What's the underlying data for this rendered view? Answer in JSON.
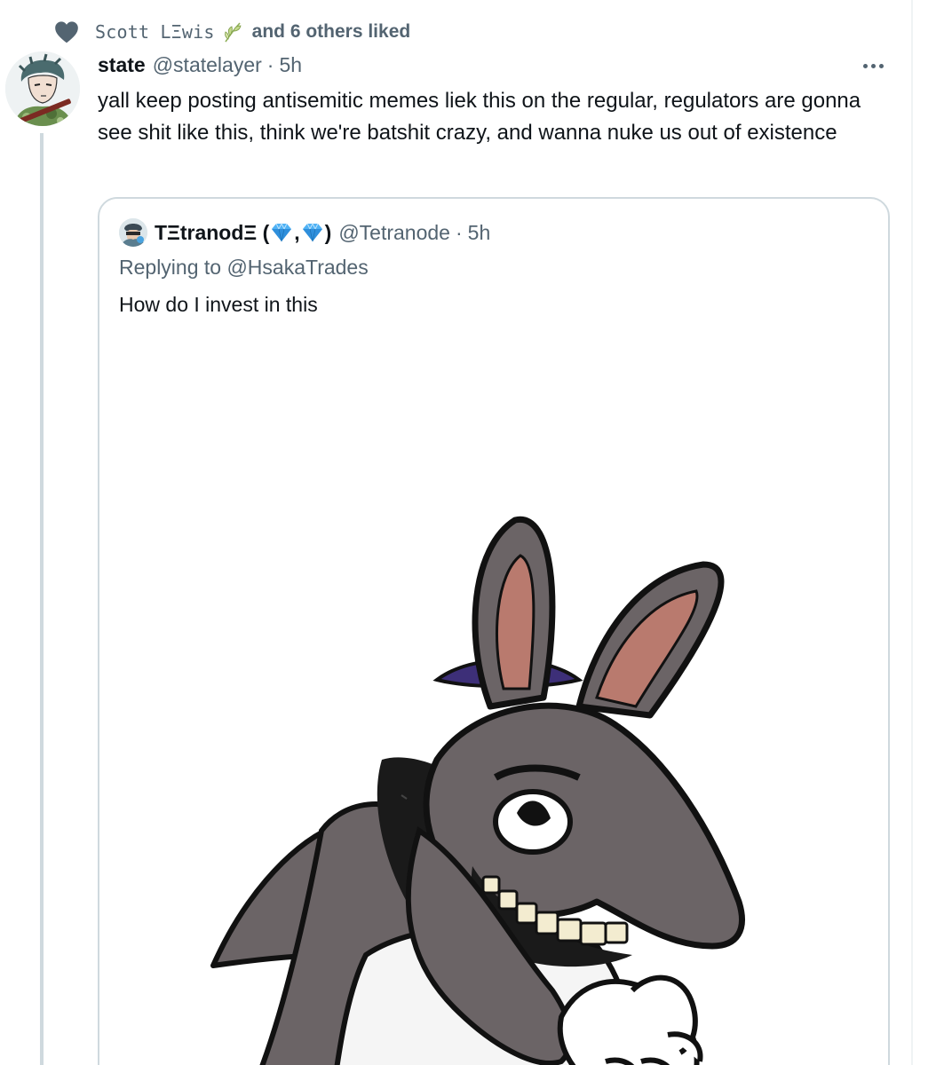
{
  "social_context": {
    "liker_name": "Scott LΞwis",
    "liked_text": "and 6 others liked"
  },
  "tweet": {
    "display_name": "state",
    "handle": "@statelayer",
    "separator": "·",
    "time": "5h",
    "text": "yall keep posting antisemitic memes liek this on the regular, regulators are gonna see shit like this, think we're batshit crazy, and wanna nuke us out of existence"
  },
  "quote": {
    "name_prefix": "TΞtranodΞ (",
    "name_mid": ",",
    "name_suffix": ")",
    "handle": "@Tetranode",
    "separator": "·",
    "time": "5h",
    "replying_to": "Replying to @HsakaTrades",
    "text": "How do I invest in this"
  },
  "colors": {
    "text_primary": "#0f1419",
    "text_secondary": "#536471",
    "border": "#cfd9de",
    "gem": "#3ba4f0"
  },
  "icons": [
    "heart-icon",
    "leaf-icon",
    "more-icon",
    "gem-icon"
  ]
}
